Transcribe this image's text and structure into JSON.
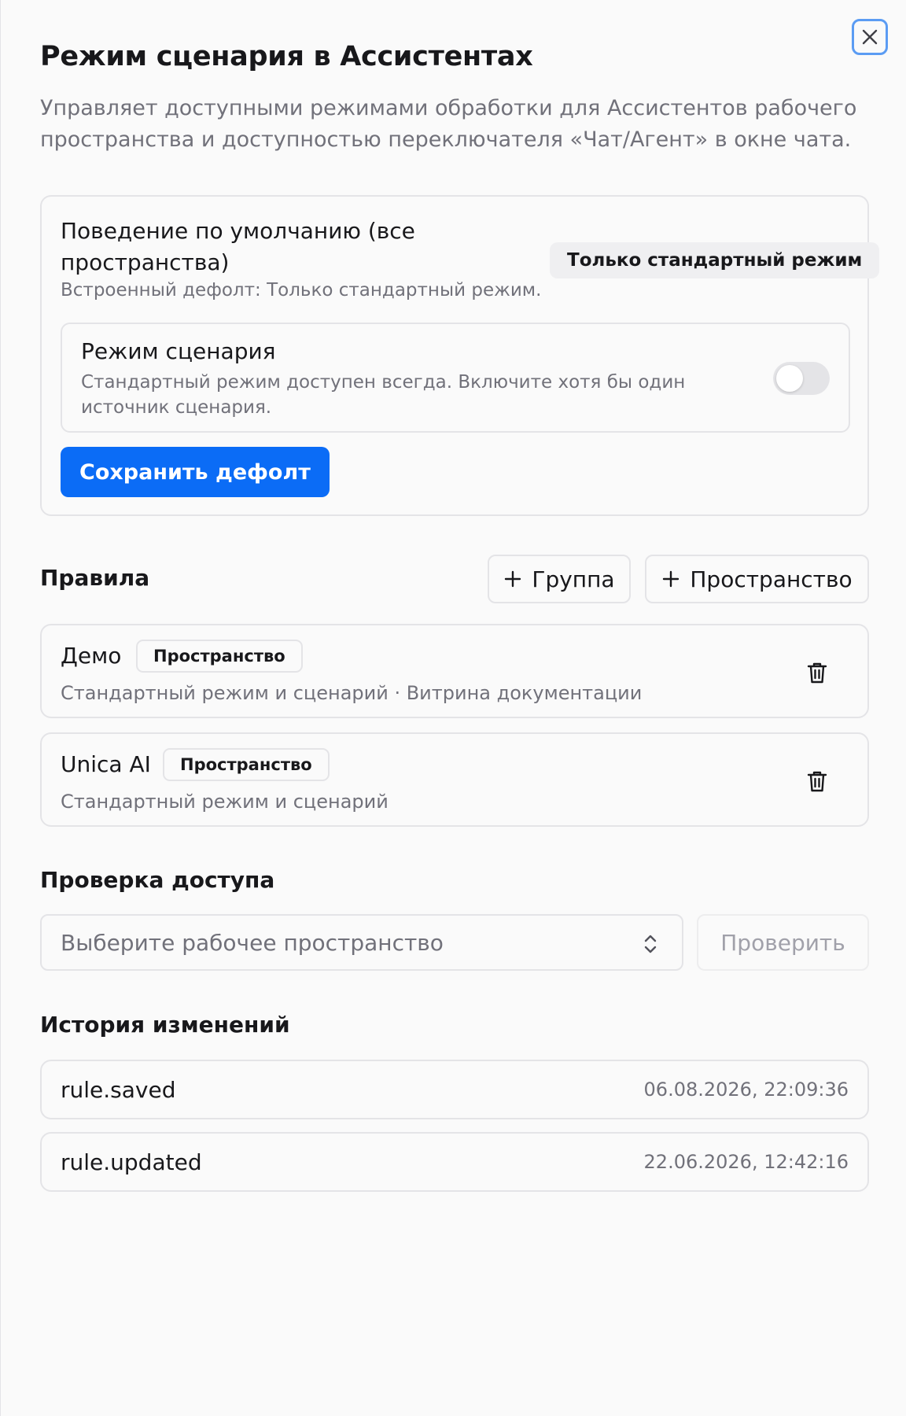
{
  "dialog": {
    "title": "Режим сценария в Ассистентах",
    "subtitle": "Управляет доступными режимами обработки для Ассистентов рабочего пространства и доступностью переключателя «Чат/Агент» в окне чата.",
    "close_icon": "close-icon"
  },
  "default_behavior": {
    "title": "Поведение по умолчанию (все пространства)",
    "badge": "Только стандартный режим",
    "note": "Встроенный дефолт: Только стандартный режим.",
    "scenario": {
      "title": "Режим сценария",
      "description": "Стандартный режим доступен всегда. Включите хотя бы один источник сценария.",
      "enabled": false
    },
    "save_label": "Сохранить дефолт"
  },
  "rules": {
    "title": "Правила",
    "add_group_label": "Группа",
    "add_space_label": "Пространство",
    "items": [
      {
        "name": "Демо",
        "tag": "Пространство",
        "description": "Стандартный режим и сценарий  · Витрина документации"
      },
      {
        "name": "Unica AI",
        "tag": "Пространство",
        "description": "Стандартный режим и сценарий"
      }
    ]
  },
  "access_check": {
    "title": "Проверка доступа",
    "select_placeholder": "Выберите рабочее пространство",
    "check_label": "Проверить"
  },
  "history": {
    "title": "История изменений",
    "items": [
      {
        "event": "rule.saved",
        "time": "06.08.2026, 22:09:36"
      },
      {
        "event": "rule.updated",
        "time": "22.06.2026, 12:42:16"
      }
    ]
  },
  "colors": {
    "primary": "#0b6cf6",
    "focus_ring": "#5b9cf3",
    "border": "#e4e4e7",
    "muted_text": "#71717a"
  }
}
